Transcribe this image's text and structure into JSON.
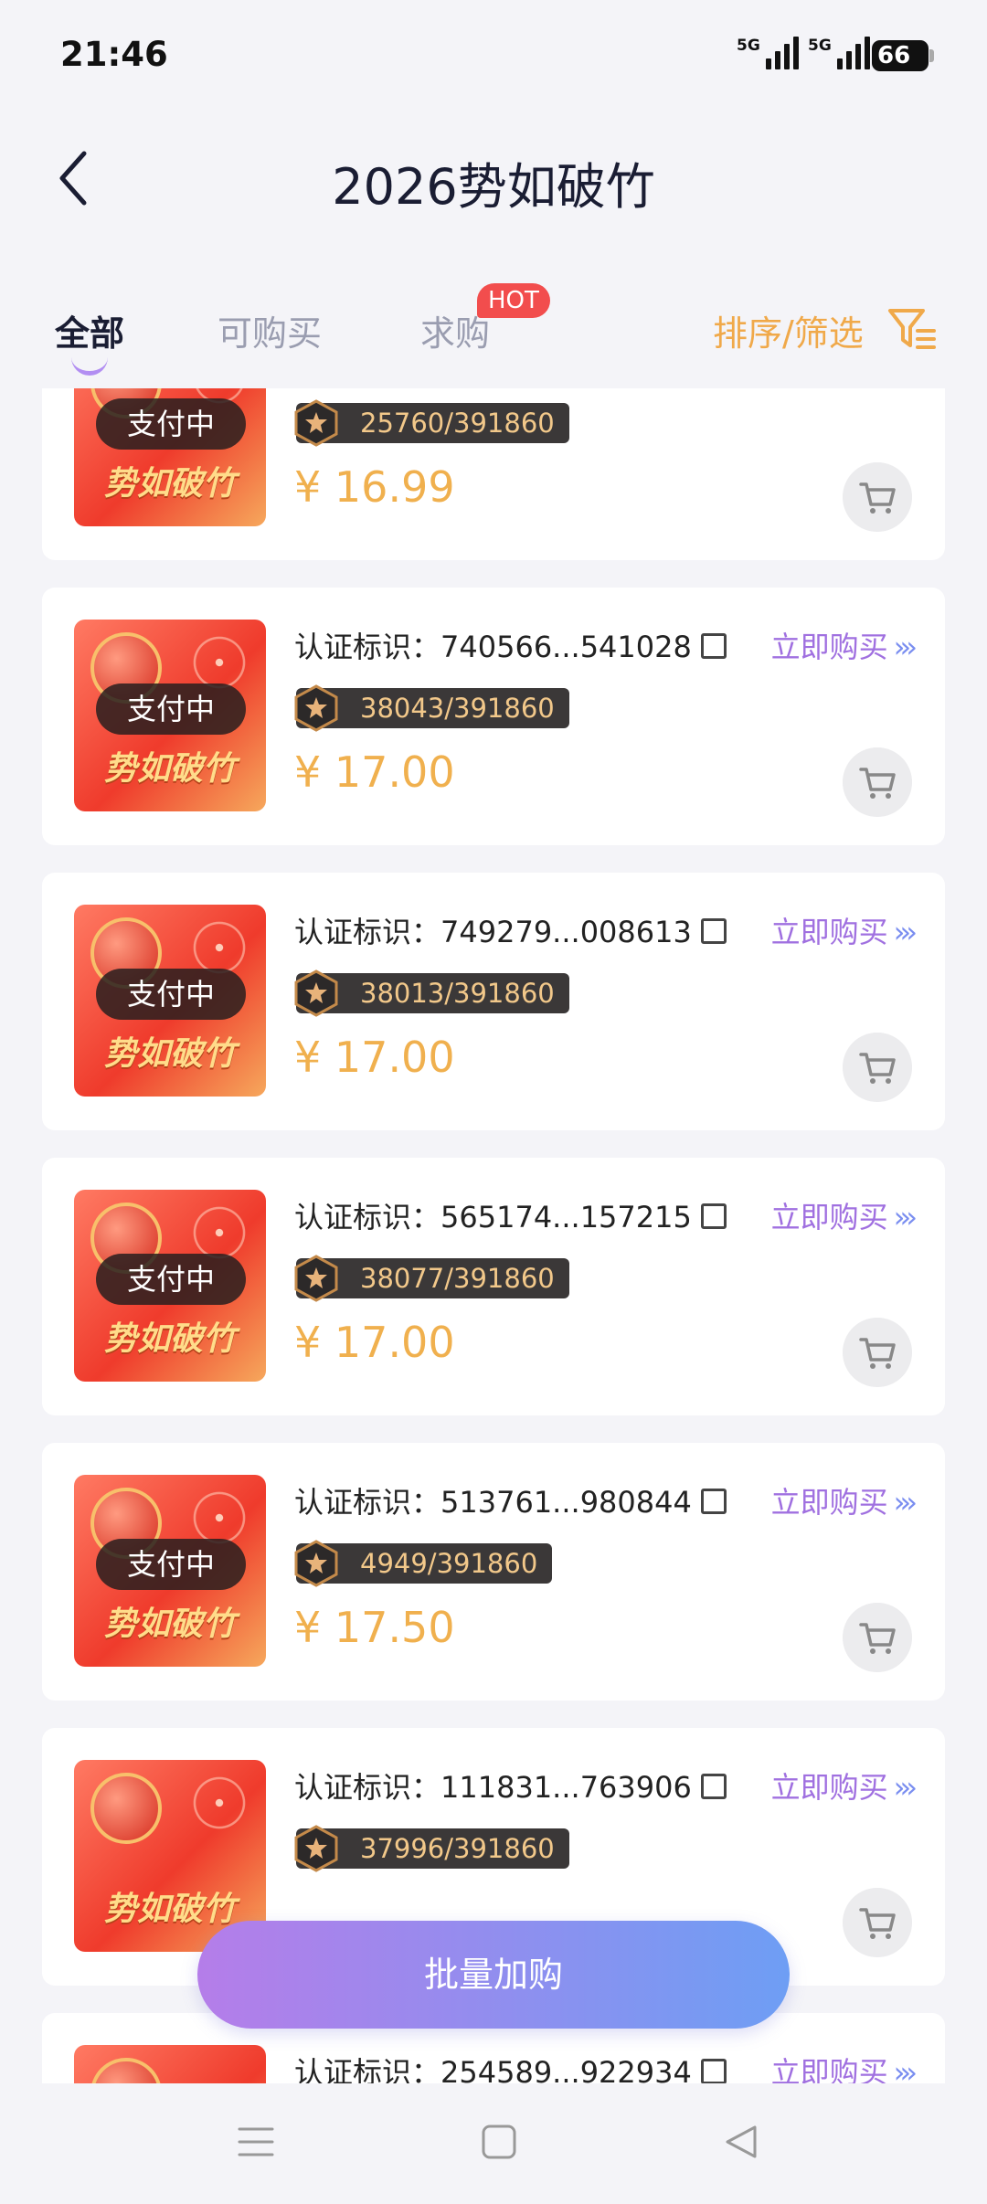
{
  "status_bar": {
    "time": "21:46",
    "sig1_label": "5G",
    "sig2_label": "5G",
    "battery": "66"
  },
  "header": {
    "title": "2026势如破竹"
  },
  "tabs": [
    {
      "label": "全部",
      "active": true
    },
    {
      "label": "可购买"
    },
    {
      "label": "求购",
      "badge": "HOT"
    }
  ],
  "sort_filter_label": "排序/筛选",
  "listing": {
    "cert_prefix": "认证标识：",
    "buy_label": "立即购买",
    "paying_label": "支付中",
    "thumb_brand": "势如破竹",
    "currency": "¥"
  },
  "items": [
    {
      "cert": "",
      "serial": "25760/391860",
      "price": "16.99",
      "paying": true
    },
    {
      "cert": "740566...541028",
      "serial": "38043/391860",
      "price": "17.00",
      "paying": true
    },
    {
      "cert": "749279...008613",
      "serial": "38013/391860",
      "price": "17.00",
      "paying": true
    },
    {
      "cert": "565174...157215",
      "serial": "38077/391860",
      "price": "17.00",
      "paying": true
    },
    {
      "cert": "513761...980844",
      "serial": "4949/391860",
      "price": "17.50",
      "paying": true
    },
    {
      "cert": "111831...763906",
      "serial": "37996/391860",
      "price": "",
      "paying": false
    },
    {
      "cert": "254589...922934",
      "serial": "",
      "price": "",
      "paying": false
    }
  ],
  "batch_button": "批量加购",
  "colors": {
    "accent_purple": "#a070e0",
    "price_orange": "#f0b04e",
    "hot_red": "#f24d4d",
    "batch_start": "#b57de9",
    "batch_end": "#6e9ef4"
  }
}
